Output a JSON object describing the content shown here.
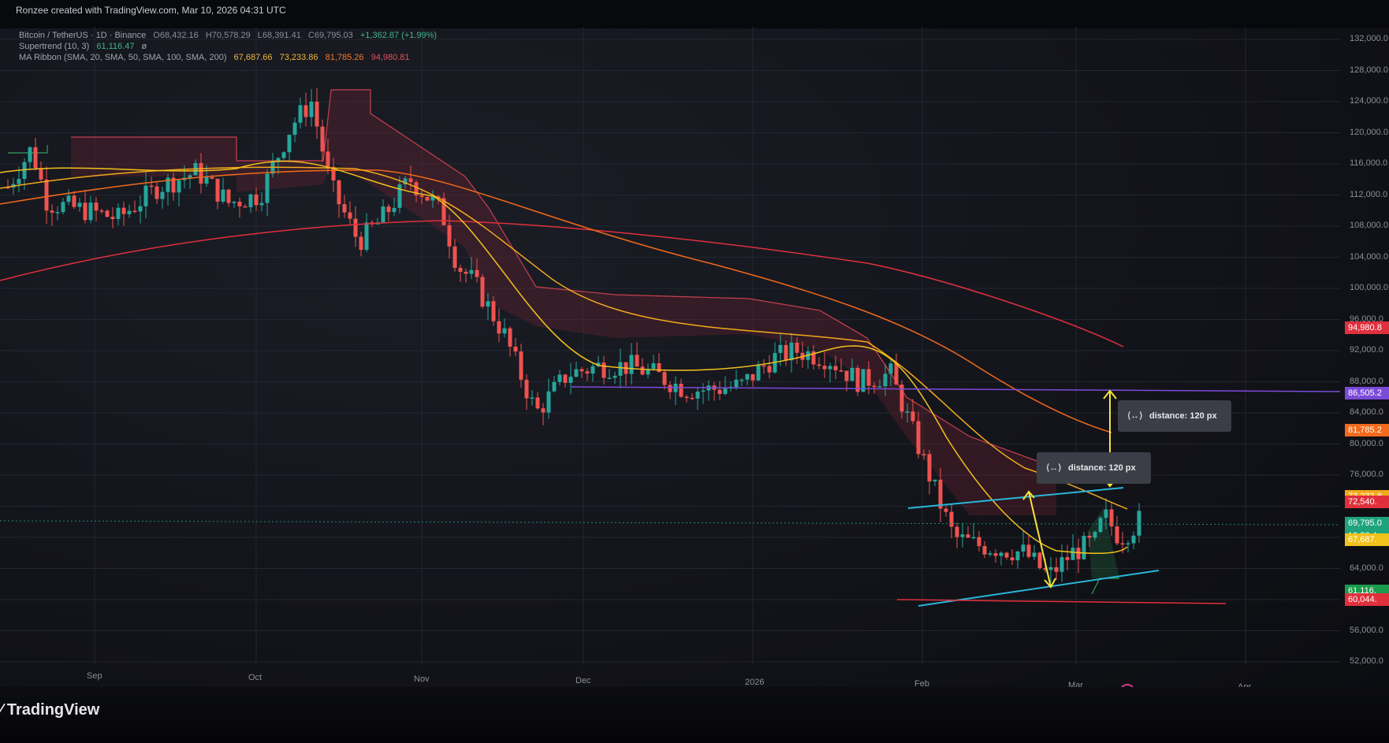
{
  "watermark": "Ronzee created with TradingView.com, Mar 10, 2026 04:31 UTC",
  "brand": "TradingView",
  "legend": {
    "symbol": "Bitcoin / TetherUS · 1D · Binance",
    "open": "O68,432.16",
    "high": "H70,578.29",
    "low": "L68,391.41",
    "close": "C69,795.03",
    "change": "+1,362.87 (+1.99%)",
    "supertrend_label": "Supertrend (10, 3)",
    "supertrend_value": "61,116.47",
    "supertrend_suffix": "ø",
    "ma_label": "MA Ribbon (SMA, 20, SMA, 50, SMA, 100, SMA, 200)",
    "ma_values": [
      "67,687.66",
      "73,233.86",
      "81,785.26",
      "94,980.81"
    ]
  },
  "price_axis": [
    "132,000.0",
    "128,000.0",
    "124,000.0",
    "120,000.0",
    "116,000.0",
    "112,000.0",
    "108,000.0",
    "104,000.0",
    "100,000.0",
    "96,000.0",
    "92,000.0",
    "88,000.0",
    "84,000.0",
    "80,000.0",
    "76,000.0",
    "64,000.0",
    "56,000.0",
    "52,000.0"
  ],
  "price_labels": [
    {
      "text": "94,980.8",
      "color": "#e0303d"
    },
    {
      "text": "86,505.2",
      "color": "#7b4ad9"
    },
    {
      "text": "81,785.2",
      "color": "#f26a1b"
    },
    {
      "text": "73,233.8",
      "color": "#f2a91c"
    },
    {
      "text": "72,540.",
      "color": "#e0303d"
    },
    {
      "text": "69,795.0",
      "color": "#1fa37d"
    },
    {
      "text": "19:28:4",
      "color": "#1fa37d"
    },
    {
      "text": "67,687.",
      "color": "#f2c21c"
    },
    {
      "text": "61,116.",
      "color": "#1c9a4e"
    },
    {
      "text": "60,044.",
      "color": "#e0303d"
    }
  ],
  "time_axis": [
    "Sep",
    "Oct",
    "Nov",
    "Dec",
    "2026",
    "Feb",
    "Mar",
    "Apr"
  ],
  "tooltips": [
    {
      "text": "distance: 120 px",
      "icon": "⟨↔⟩"
    },
    {
      "text": "distance: 120 px",
      "icon": "⟨↔⟩"
    }
  ],
  "colors": {
    "up": "#26a69a",
    "down": "#ef5350",
    "ma20": "#f2c21c",
    "ma50": "#f2a91c",
    "ma100": "#f26a1b",
    "ma200": "#e0303d",
    "support": "#7b4ad9",
    "channel": "#29b6d8"
  }
}
